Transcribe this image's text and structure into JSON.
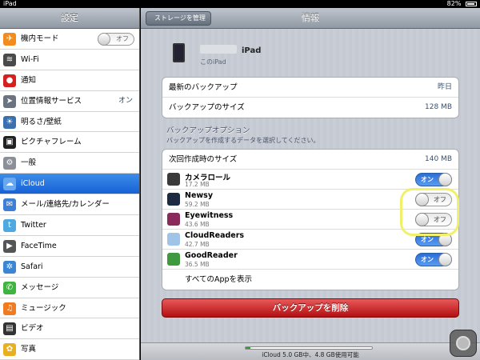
{
  "status": {
    "carrier": "iPad",
    "battery": "82%"
  },
  "sidebar": {
    "title": "設定",
    "items": [
      {
        "label": "機内モード",
        "icon": "airplane-icon",
        "color": "#f28c1c",
        "switch": "オフ"
      },
      {
        "label": "Wi-Fi",
        "icon": "wifi-icon",
        "color": "#4a4a4a"
      },
      {
        "label": "通知",
        "icon": "notification-icon",
        "color": "#d62020"
      },
      {
        "label": "位置情報サービス",
        "icon": "location-icon",
        "color": "#6b7380",
        "value": "オン"
      },
      {
        "label": "明るさ/壁紙",
        "icon": "brightness-icon",
        "color": "#3b6fb0"
      },
      {
        "label": "ピクチャフレーム",
        "icon": "picture-frame-icon",
        "color": "#222222"
      },
      {
        "label": "一般",
        "icon": "gear-icon",
        "color": "#8a8f98"
      },
      {
        "label": "iCloud",
        "icon": "cloud-icon",
        "color": "#6aa8ee",
        "active": true
      },
      {
        "label": "メール/連絡先/カレンダー",
        "icon": "mail-icon",
        "color": "#3b7fd6"
      },
      {
        "label": "Twitter",
        "icon": "twitter-icon",
        "color": "#4fa8e0"
      },
      {
        "label": "FaceTime",
        "icon": "facetime-icon",
        "color": "#555555"
      },
      {
        "label": "Safari",
        "icon": "safari-icon",
        "color": "#3a86d4"
      },
      {
        "label": "メッセージ",
        "icon": "messages-icon",
        "color": "#3fb441"
      },
      {
        "label": "ミュージック",
        "icon": "music-icon",
        "color": "#f07b20"
      },
      {
        "label": "ビデオ",
        "icon": "video-icon",
        "color": "#333333"
      },
      {
        "label": "写真",
        "icon": "photos-icon",
        "color": "#e8b020"
      }
    ]
  },
  "navbar": {
    "back_label": "ストレージを管理",
    "title": "情報"
  },
  "device": {
    "name": "iPad",
    "subtitle": "このiPad"
  },
  "backup_info": [
    {
      "label": "最新のバックアップ",
      "value": "昨日"
    },
    {
      "label": "バックアップのサイズ",
      "value": "128 MB"
    }
  ],
  "backup_options": {
    "title": "バックアップオプション",
    "subtitle": "バックアップを作成するデータを選択してください。",
    "next_size_label": "次回作成時のサイズ",
    "next_size_value": "140 MB",
    "apps": [
      {
        "name": "カメラロール",
        "size": "17.2 MB",
        "state": "on",
        "state_label": "オン",
        "icon": "camera-roll-icon",
        "color": "#3a3a3a"
      },
      {
        "name": "Newsy",
        "size": "59.2 MB",
        "state": "off",
        "state_label": "オフ",
        "icon": "newsy-icon",
        "color": "#1d2a44"
      },
      {
        "name": "Eyewitness",
        "size": "43.6 MB",
        "state": "off",
        "state_label": "オフ",
        "icon": "eyewitness-icon",
        "color": "#8a2a5a"
      },
      {
        "name": "CloudReaders",
        "size": "42.7 MB",
        "state": "on",
        "state_label": "オン",
        "icon": "cloudreaders-icon",
        "color": "#9fc4e8"
      },
      {
        "name": "GoodReader",
        "size": "36.5 MB",
        "state": "on",
        "state_label": "オン",
        "icon": "goodreader-icon",
        "color": "#3f9a3f"
      }
    ],
    "show_all_label": "すべてのAppを表示"
  },
  "delete_button_label": "バックアップを削除",
  "footer": {
    "storage_text": "iCloud 5.0 GB中、4.8 GB使用可能",
    "used_fraction": 0.04
  }
}
